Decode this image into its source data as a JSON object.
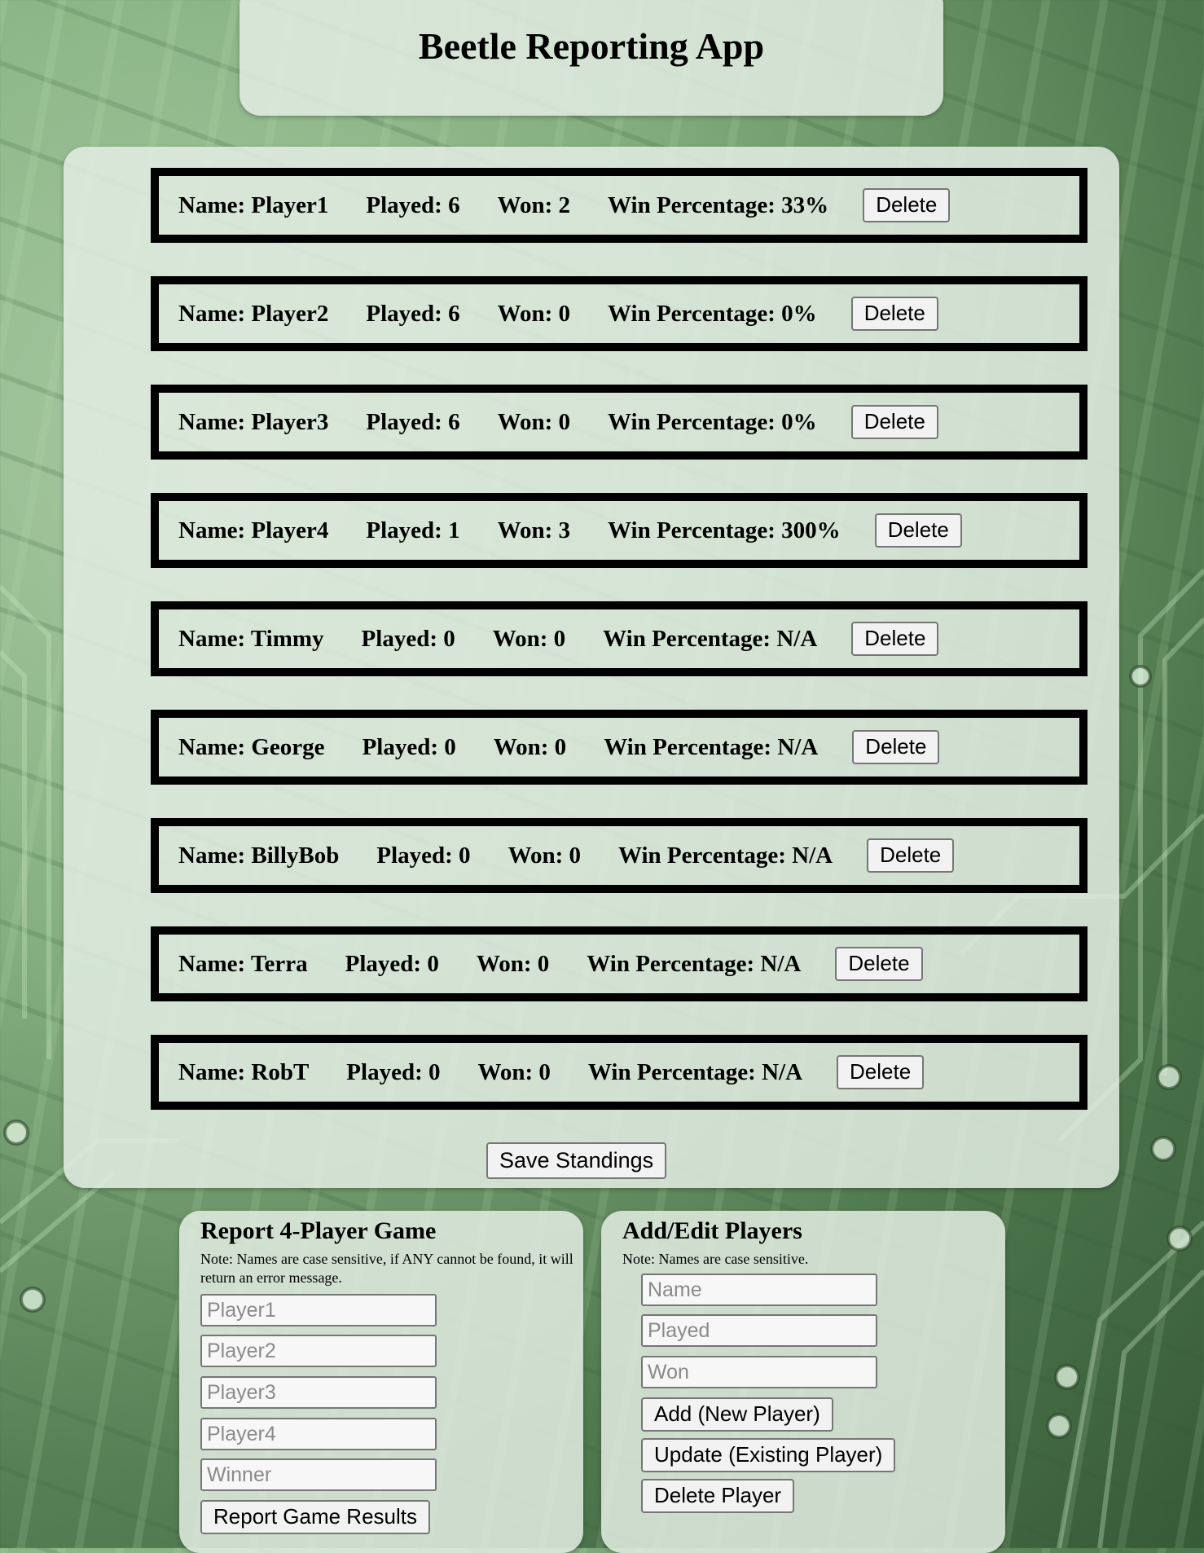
{
  "app_title": "Beetle Reporting App",
  "players": [
    {
      "name": "Name: Player1",
      "played": "Played: 6",
      "won": "Won: 2",
      "pct": "Win Percentage: 33%",
      "delete": "Delete"
    },
    {
      "name": "Name: Player2",
      "played": "Played: 6",
      "won": "Won: 0",
      "pct": "Win Percentage: 0%",
      "delete": "Delete"
    },
    {
      "name": "Name: Player3",
      "played": "Played: 6",
      "won": "Won: 0",
      "pct": "Win Percentage: 0%",
      "delete": "Delete"
    },
    {
      "name": "Name: Player4",
      "played": "Played: 1",
      "won": "Won: 3",
      "pct": "Win Percentage: 300%",
      "delete": "Delete"
    },
    {
      "name": "Name: Timmy",
      "played": "Played: 0",
      "won": "Won: 0",
      "pct": "Win Percentage: N/A",
      "delete": "Delete"
    },
    {
      "name": "Name: George",
      "played": "Played: 0",
      "won": "Won: 0",
      "pct": "Win Percentage: N/A",
      "delete": "Delete"
    },
    {
      "name": "Name: BillyBob",
      "played": "Played: 0",
      "won": "Won: 0",
      "pct": "Win Percentage: N/A",
      "delete": "Delete"
    },
    {
      "name": "Name: Terra",
      "played": "Played: 0",
      "won": "Won: 0",
      "pct": "Win Percentage: N/A",
      "delete": "Delete"
    },
    {
      "name": "Name: RobT",
      "played": "Played: 0",
      "won": "Won: 0",
      "pct": "Win Percentage: N/A",
      "delete": "Delete"
    }
  ],
  "save_label": "Save Standings",
  "report": {
    "title": "Report 4-Player Game",
    "note": "Note: Names are case sensitive, if ANY cannot be found, it will return an error message.",
    "placeholders": [
      "Player1",
      "Player2",
      "Player3",
      "Player4",
      "Winner"
    ],
    "submit_label": "Report Game Results"
  },
  "edit": {
    "title": "Add/Edit Players",
    "note": "Note: Names are case sensitive.",
    "placeholders": [
      "Name",
      "Played",
      "Won"
    ],
    "add_label": "Add (New Player)",
    "update_label": "Update (Existing Player)",
    "delete_label": "Delete Player"
  }
}
